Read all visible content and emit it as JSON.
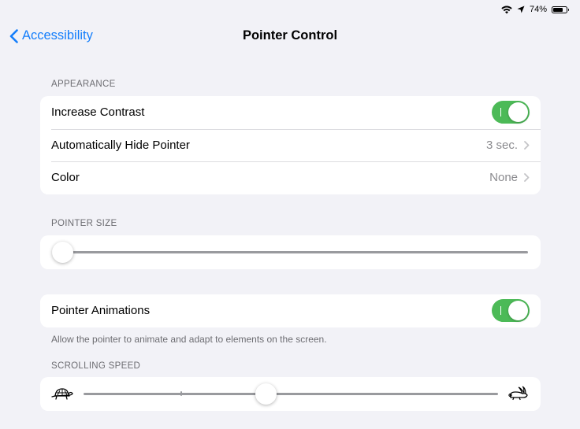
{
  "status_bar": {
    "battery": "74%",
    "icons": [
      "wifi-icon",
      "location-arrow-icon",
      "battery-icon"
    ]
  },
  "nav": {
    "back_label": "Accessibility",
    "title": "Pointer Control"
  },
  "appearance": {
    "header": "APPEARANCE",
    "rows": [
      {
        "label": "Increase Contrast",
        "toggle_on": true
      },
      {
        "label": "Automatically Hide Pointer",
        "value": "3 sec."
      },
      {
        "label": "Color",
        "value": "None"
      }
    ]
  },
  "pointer_size": {
    "header": "POINTER SIZE",
    "level": 0.0
  },
  "animations": {
    "label": "Pointer Animations",
    "toggle_on": true,
    "footer": "Allow the pointer to animate and adapt to elements on the screen."
  },
  "scrolling_speed": {
    "header": "SCROLLING SPEED",
    "level": 0.44,
    "min_icon": "turtle-icon",
    "max_icon": "rabbit-icon"
  },
  "colors": {
    "accent": "#147efb",
    "toggle_on": "#4cba57",
    "background": "#f2f2f7"
  }
}
